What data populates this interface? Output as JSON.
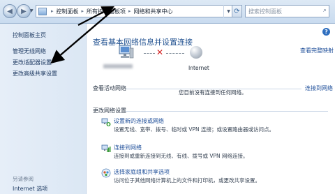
{
  "addressbar": {
    "back_glyph": "◀",
    "forward_glyph": "▶",
    "breadcrumbs": [
      "控制面板",
      "所有控制面板项",
      "网络和共享中心"
    ],
    "separator": "▸",
    "search_placeholder": "搜索控制面板"
  },
  "sidebar": {
    "home": "控制面板主页",
    "links": [
      "管理无线网络",
      "更改适配器设置",
      "更改高级共享设置"
    ],
    "see_also_heading": "另请参阅",
    "see_also": [
      "Internet 选项"
    ]
  },
  "main": {
    "title": "查看基本网络信息并设置连接",
    "full_map": "查看完整映射",
    "internet_label": "Internet",
    "active_networks_heading": "查看活动网络",
    "connect_link": "连接到网络",
    "not_connected_text": "您目前没有连接到任何网络。",
    "change_settings_heading": "更改网络设置",
    "tasks": [
      {
        "icon": "new-connection-icon",
        "link": "设置新的连接或网络",
        "desc": "设置无线、宽带、拨号、临时或 VPN 连接；或设置路由器或访问点。"
      },
      {
        "icon": "connect-network-icon",
        "link": "连接到网络",
        "desc": "连接到或重新连接到无线、有线、拨号或 VPN 网络连接。"
      },
      {
        "icon": "homegroup-icon",
        "link": "选择家庭组和共享选项",
        "desc": "访问位于其他网络计算机上的文件和打印机，或更改共享设置。"
      }
    ]
  },
  "colors": {
    "link": "#1f4f9a",
    "title": "#1e4f8f",
    "error_x": "#d21f1f",
    "arrow": "#000000"
  }
}
